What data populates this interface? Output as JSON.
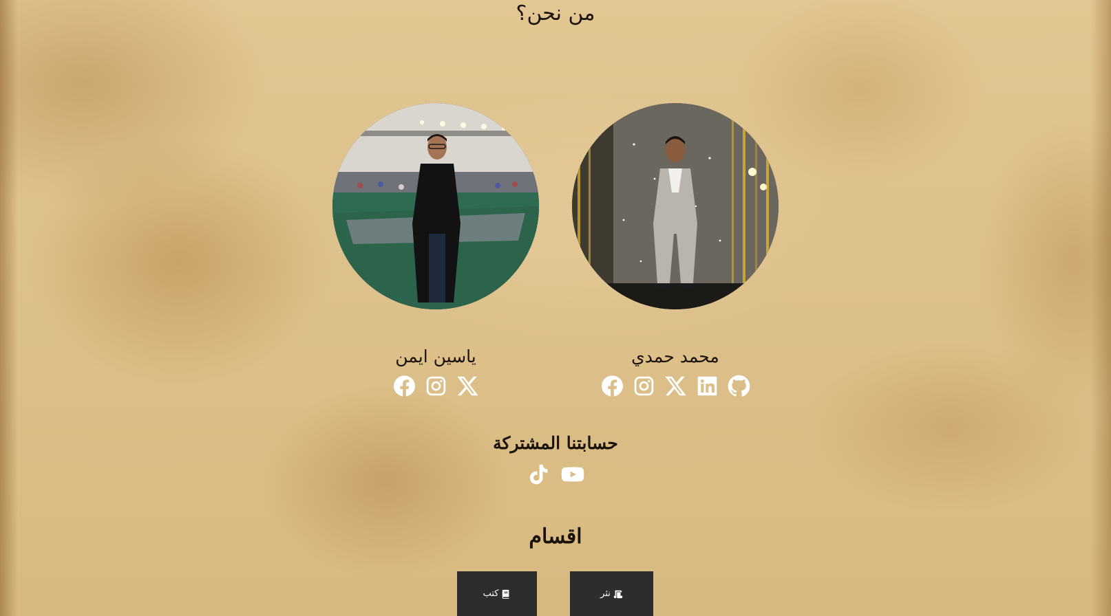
{
  "page": {
    "title": "من نحن؟"
  },
  "members": [
    {
      "name": "محمد حمدي",
      "photo": "photo-man-grey-suit",
      "socials": [
        {
          "icon": "facebook-icon"
        },
        {
          "icon": "instagram-icon"
        },
        {
          "icon": "x-icon"
        },
        {
          "icon": "linkedin-icon"
        },
        {
          "icon": "github-icon"
        }
      ]
    },
    {
      "name": "ياسين ايمن",
      "photo": "photo-man-black-shirt",
      "socials": [
        {
          "icon": "facebook-icon"
        },
        {
          "icon": "instagram-icon"
        },
        {
          "icon": "x-icon"
        }
      ]
    }
  ],
  "shared": {
    "title": "حسابتنا المشتركة",
    "socials": [
      {
        "icon": "tiktok-icon"
      },
      {
        "icon": "youtube-icon"
      }
    ]
  },
  "sections": {
    "title": "اقسام",
    "buttons": [
      {
        "label": "نثر",
        "icon": "scroll-icon"
      },
      {
        "label": "كتب",
        "icon": "book-icon"
      }
    ]
  },
  "colors": {
    "background": "#ddc18c",
    "text": "#1a1208",
    "icon": "#ffffff",
    "button_bg": "#2d2d2d"
  }
}
